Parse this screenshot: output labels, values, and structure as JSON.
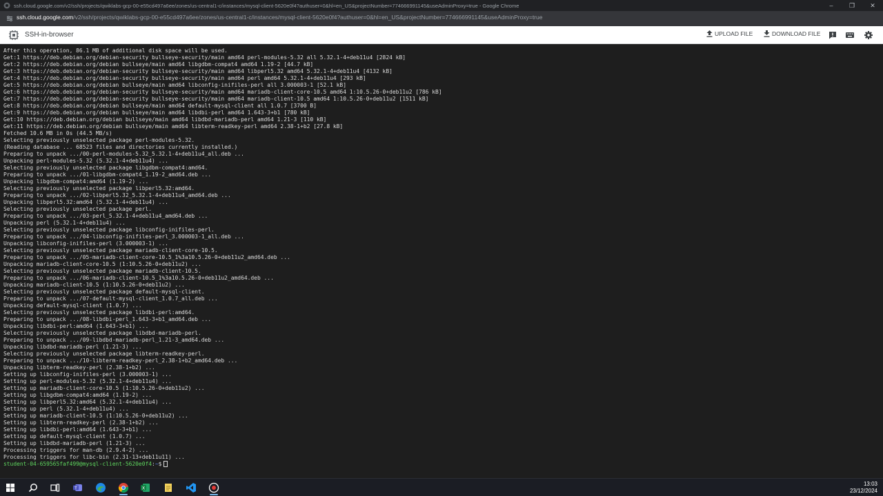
{
  "window": {
    "title": "ssh.cloud.google.com/v2/ssh/projects/qwiklabs-gcp-00-e55cd497a6ee/zones/us-central1-c/instances/mysql-client-5620e0f4?authuser=0&hl=en_US&projectNumber=774666991145&useAdminProxy=true - Google Chrome",
    "minimize_icon": "minimize-icon",
    "restore_icon": "restore-icon",
    "close_icon": "close-icon"
  },
  "address_bar": {
    "host": "ssh.cloud.google.com",
    "path": "/v2/ssh/projects/qwiklabs-gcp-00-e55cd497a6ee/zones/us-central1-c/instances/mysql-client-5620e0f4?authuser=0&hl=en_US&projectNumber=774666991145&useAdminProxy=true"
  },
  "ssh_header": {
    "title": "SSH-in-browser",
    "upload_label": "UPLOAD FILE",
    "download_label": "DOWNLOAD FILE"
  },
  "terminal": {
    "lines": [
      "After this operation, 86.1 MB of additional disk space will be used.",
      "Get:1 https://deb.debian.org/debian-security bullseye-security/main amd64 perl-modules-5.32 all 5.32.1-4+deb11u4 [2824 kB]",
      "Get:2 https://deb.debian.org/debian bullseye/main amd64 libgdbm-compat4 amd64 1.19-2 [44.7 kB]",
      "Get:3 https://deb.debian.org/debian-security bullseye-security/main amd64 libperl5.32 amd64 5.32.1-4+deb11u4 [4132 kB]",
      "Get:4 https://deb.debian.org/debian-security bullseye-security/main amd64 perl amd64 5.32.1-4+deb11u4 [293 kB]",
      "Get:5 https://deb.debian.org/debian bullseye/main amd64 libconfig-inifiles-perl all 3.000003-1 [52.1 kB]",
      "Get:6 https://deb.debian.org/debian-security bullseye-security/main amd64 mariadb-client-core-10.5 amd64 1:10.5.26-0+deb11u2 [786 kB]",
      "Get:7 https://deb.debian.org/debian-security bullseye-security/main amd64 mariadb-client-10.5 amd64 1:10.5.26-0+deb11u2 [1511 kB]",
      "Get:8 https://deb.debian.org/debian bullseye/main amd64 default-mysql-client all 1.0.7 [3700 B]",
      "Get:9 https://deb.debian.org/debian bullseye/main amd64 libdbi-perl amd64 1.643-3+b1 [780 kB]",
      "Get:10 https://deb.debian.org/debian bullseye/main amd64 libdbd-mariadb-perl amd64 1.21-3 [110 kB]",
      "Get:11 https://deb.debian.org/debian bullseye/main amd64 libterm-readkey-perl amd64 2.38-1+b2 [27.8 kB]",
      "Fetched 10.6 MB in 0s (44.5 MB/s)",
      "Selecting previously unselected package perl-modules-5.32.",
      "(Reading database ... 68523 files and directories currently installed.)",
      "Preparing to unpack .../00-perl-modules-5.32_5.32.1-4+deb11u4_all.deb ...",
      "Unpacking perl-modules-5.32 (5.32.1-4+deb11u4) ...",
      "Selecting previously unselected package libgdbm-compat4:amd64.",
      "Preparing to unpack .../01-libgdbm-compat4_1.19-2_amd64.deb ...",
      "Unpacking libgdbm-compat4:amd64 (1.19-2) ...",
      "Selecting previously unselected package libperl5.32:amd64.",
      "Preparing to unpack .../02-libperl5.32_5.32.1-4+deb11u4_amd64.deb ...",
      "Unpacking libperl5.32:amd64 (5.32.1-4+deb11u4) ...",
      "Selecting previously unselected package perl.",
      "Preparing to unpack .../03-perl_5.32.1-4+deb11u4_amd64.deb ...",
      "Unpacking perl (5.32.1-4+deb11u4) ...",
      "Selecting previously unselected package libconfig-inifiles-perl.",
      "Preparing to unpack .../04-libconfig-inifiles-perl_3.000003-1_all.deb ...",
      "Unpacking libconfig-inifiles-perl (3.000003-1) ...",
      "Selecting previously unselected package mariadb-client-core-10.5.",
      "Preparing to unpack .../05-mariadb-client-core-10.5_1%3a10.5.26-0+deb11u2_amd64.deb ...",
      "Unpacking mariadb-client-core-10.5 (1:10.5.26-0+deb11u2) ...",
      "Selecting previously unselected package mariadb-client-10.5.",
      "Preparing to unpack .../06-mariadb-client-10.5_1%3a10.5.26-0+deb11u2_amd64.deb ...",
      "Unpacking mariadb-client-10.5 (1:10.5.26-0+deb11u2) ...",
      "Selecting previously unselected package default-mysql-client.",
      "Preparing to unpack .../07-default-mysql-client_1.0.7_all.deb ...",
      "Unpacking default-mysql-client (1.0.7) ...",
      "Selecting previously unselected package libdbi-perl:amd64.",
      "Preparing to unpack .../08-libdbi-perl_1.643-3+b1_amd64.deb ...",
      "Unpacking libdbi-perl:amd64 (1.643-3+b1) ...",
      "Selecting previously unselected package libdbd-mariadb-perl.",
      "Preparing to unpack .../09-libdbd-mariadb-perl_1.21-3_amd64.deb ...",
      "Unpacking libdbd-mariadb-perl (1.21-3) ...",
      "Selecting previously unselected package libterm-readkey-perl.",
      "Preparing to unpack .../10-libterm-readkey-perl_2.38-1+b2_amd64.deb ...",
      "Unpacking libterm-readkey-perl (2.38-1+b2) ...",
      "Setting up libconfig-inifiles-perl (3.000003-1) ...",
      "Setting up perl-modules-5.32 (5.32.1-4+deb11u4) ...",
      "Setting up mariadb-client-core-10.5 (1:10.5.26-0+deb11u2) ...",
      "Setting up libgdbm-compat4:amd64 (1.19-2) ...",
      "Setting up libperl5.32:amd64 (5.32.1-4+deb11u4) ...",
      "Setting up perl (5.32.1-4+deb11u4) ...",
      "Setting up mariadb-client-10.5 (1:10.5.26-0+deb11u2) ...",
      "Setting up libterm-readkey-perl (2.38-1+b2) ...",
      "Setting up libdbi-perl:amd64 (1.643-3+b1) ...",
      "Setting up default-mysql-client (1.0.7) ...",
      "Setting up libdbd-mariadb-perl (1.21-3) ...",
      "Processing triggers for man-db (2.9.4-2) ...",
      "Processing triggers for libc-bin (2.31-13+deb11u11) ..."
    ],
    "prompt_user": "student-04-659565faf499@mysql-client-5620e0f4",
    "prompt_path": "~",
    "prompt_symbol": "$"
  },
  "taskbar": {
    "items": [
      {
        "name": "windows-start-icon"
      },
      {
        "name": "search-icon"
      },
      {
        "name": "task-view-icon"
      },
      {
        "name": "teams-icon"
      },
      {
        "name": "edge-icon"
      },
      {
        "name": "chrome-icon"
      },
      {
        "name": "excel-icon"
      },
      {
        "name": "notepad-icon"
      },
      {
        "name": "vscode-icon"
      },
      {
        "name": "recorder-icon"
      }
    ],
    "time": "13:03",
    "date": "23/12/2024"
  },
  "colors": {
    "terminal_bg": "#1e1e1e",
    "terminal_fg": "#dcdcdc",
    "prompt_user": "#5fd75f",
    "prompt_path": "#5f87ff"
  }
}
